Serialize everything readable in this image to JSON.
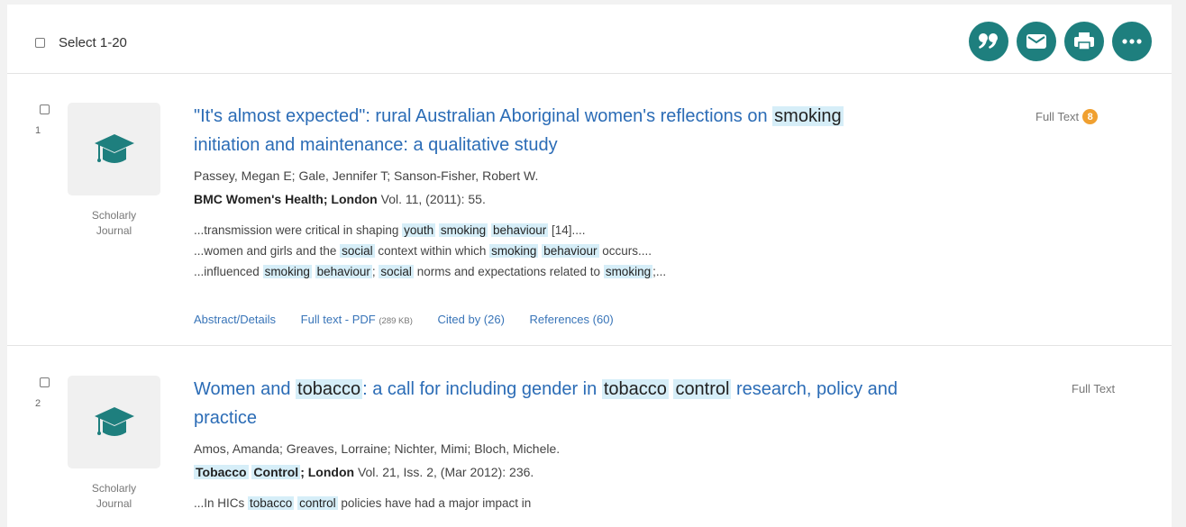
{
  "toolbar": {
    "select_label": "Select 1-20",
    "actions": [
      {
        "name": "cite",
        "icon": "quote-icon"
      },
      {
        "name": "email",
        "icon": "envelope-icon"
      },
      {
        "name": "print",
        "icon": "printer-icon"
      },
      {
        "name": "more",
        "icon": "ellipsis-icon"
      }
    ],
    "accent_color": "#1e7f7e"
  },
  "results": [
    {
      "number": "1",
      "doc_type_line1": "Scholarly",
      "doc_type_line2": "Journal",
      "title_parts": [
        "\"It's almost expected\": rural Australian Aboriginal women's reflections on ",
        "smoking",
        "initiation and maintenance: a qualitative study"
      ],
      "authors": "Passey, Megan E; Gale, Jennifer T; Sanson-Fisher, Robert W.",
      "source_bold": "BMC Women's Health; London",
      "source_rest": " Vol. 11,  (2011): 55.",
      "snippets": [
        [
          "...transmission were critical in shaping ",
          "youth",
          " ",
          "smoking",
          " ",
          "behaviour",
          " [14]...."
        ],
        [
          "...women and girls and the ",
          "social",
          " context within which ",
          "smoking",
          " ",
          "behaviour",
          " occurs...."
        ],
        [
          "...influenced ",
          "smoking",
          " ",
          "behaviour",
          "; ",
          "social",
          " norms and expectations related to ",
          "smoking",
          ";..."
        ]
      ],
      "links": {
        "abstract": "Abstract/Details",
        "fulltext_pdf": "Full text - PDF",
        "pdf_size": "(289 KB)",
        "cited_by": "Cited by (26)",
        "references": "References (60)"
      },
      "fulltext_label": "Full Text",
      "badge": "8"
    },
    {
      "number": "2",
      "doc_type_line1": "Scholarly",
      "doc_type_line2": "Journal",
      "title_parts": [
        "Women and ",
        "tobacco",
        ": a call for including gender in ",
        "tobacco",
        " ",
        "control",
        " research, policy and",
        "practice"
      ],
      "authors": "Amos, Amanda; Greaves, Lorraine; Nichter, Mimi; Bloch, Michele.",
      "source_hl1": "Tobacco",
      "source_hl2": "Control",
      "source_bold": "; London",
      "source_rest": " Vol. 21, Iss. 2,  (Mar 2012): 236.",
      "snippet_partial": [
        "...In HICs ",
        "tobacco",
        " ",
        "control",
        " policies have had a major impact in"
      ],
      "fulltext_label": "Full Text"
    }
  ]
}
